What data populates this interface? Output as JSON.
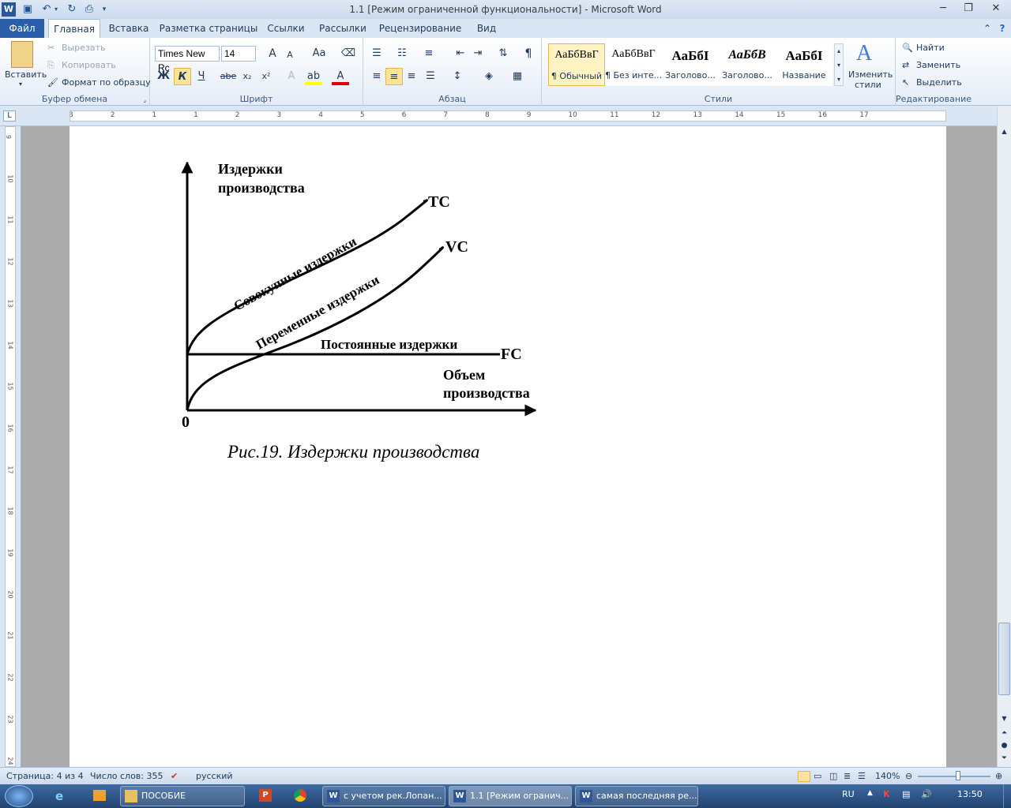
{
  "window": {
    "title": "1.1 [Режим ограниченной функциональности]  -  Microsoft Word"
  },
  "tabs": [
    "Файл",
    "Главная",
    "Вставка",
    "Разметка страницы",
    "Ссылки",
    "Рассылки",
    "Рецензирование",
    "Вид"
  ],
  "ribbon": {
    "clipboard": {
      "paste": "Вставить",
      "cut": "Вырезать",
      "copy": "Копировать",
      "format_painter": "Формат по образцу",
      "label": "Буфер обмена"
    },
    "font": {
      "name": "Times New Rc",
      "size": "14",
      "label": "Шрифт",
      "bold": "Ж",
      "italic": "К",
      "underline": "Ч",
      "strike": "abe",
      "subscript": "x₂",
      "superscript": "x²",
      "case": "Aa",
      "grow": "A",
      "shrink": "A"
    },
    "paragraph": {
      "label": "Абзац",
      "pilcrow": "¶"
    },
    "styles": {
      "label": "Стили",
      "items": [
        {
          "sample": "АаБбВвГ",
          "name": "¶ Обычный"
        },
        {
          "sample": "АаБбВвГ",
          "name": "¶ Без инте..."
        },
        {
          "sample": "АаБбІ",
          "name": "Заголово..."
        },
        {
          "sample": "АаБбВ",
          "name": "Заголово..."
        },
        {
          "sample": "АаБбІ",
          "name": "Название"
        }
      ],
      "change_line1": "Изменить",
      "change_line2": "стили"
    },
    "editing": {
      "label": "Редактирование",
      "find": "Найти",
      "replace": "Заменить",
      "select": "Выделить"
    }
  },
  "ruler": {
    "h_numbers": [
      "3",
      "2",
      "1",
      "1",
      "2",
      "3",
      "4",
      "5",
      "6",
      "7",
      "8",
      "9",
      "10",
      "11",
      "12",
      "13",
      "14",
      "15",
      "16",
      "17"
    ],
    "v_numbers": [
      "9",
      "10",
      "11",
      "12",
      "13",
      "14",
      "15",
      "16",
      "17",
      "18",
      "19",
      "20",
      "21",
      "22",
      "23",
      "24"
    ]
  },
  "figure": {
    "y_axis_line1": "Издержки",
    "y_axis_line2": "производства",
    "x_axis_line1": "Объем",
    "x_axis_line2": "производства",
    "origin": "0",
    "tc_label": "TC",
    "vc_label": "VC",
    "fc_label": "FC",
    "tc_text": "Совокупные издержки",
    "vc_text": "Переменные издержки",
    "fc_text": "Постоянные издержки",
    "caption": "Рис.19. Издержки производства"
  },
  "status": {
    "page": "Страница: 4 из 4",
    "words": "Число слов: 355",
    "lang": "русский",
    "zoom": "140%"
  },
  "taskbar": {
    "items": [
      {
        "label": "ПОСОБИЕ",
        "icon": "folder-icon"
      },
      {
        "label": "с учетом рек.Лопан...",
        "icon": "word-icon"
      },
      {
        "label": "1.1 [Режим огранич...",
        "icon": "word-icon"
      },
      {
        "label": "самая последняя ре...",
        "icon": "word-icon"
      }
    ],
    "lang": "RU",
    "time": "13:50"
  },
  "colors": {
    "accent": "#2a5ea8",
    "ribbon_bg": "#dbe6f4",
    "taskbar": "#2b4f7f"
  }
}
